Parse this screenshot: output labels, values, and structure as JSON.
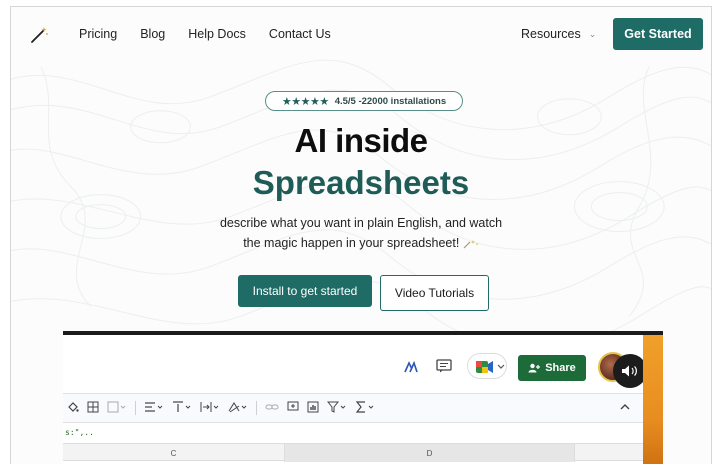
{
  "nav": {
    "links": [
      "Pricing",
      "Blog",
      "Help Docs",
      "Contact Us"
    ],
    "resources_label": "Resources",
    "cta_label": "Get Started"
  },
  "hero": {
    "rating_stars": "★★★★★",
    "rating_text": "4.5/5 -22000 installations",
    "title_line1": "AI inside",
    "title_line2": "Spreadsheets",
    "subtitle_line1": "describe what you want in plain English, and watch",
    "subtitle_line2": "the magic happen in your spreadsheet!",
    "install_label": "Install to get started",
    "video_label": "Video Tutorials"
  },
  "sheet": {
    "share_label": "Share",
    "formula_text": "s:\",..",
    "columns": [
      "C",
      "D"
    ]
  },
  "colors": {
    "brand": "#1f6b66",
    "title_accent": "#1f5c57",
    "share_green": "#1e6b3a"
  }
}
